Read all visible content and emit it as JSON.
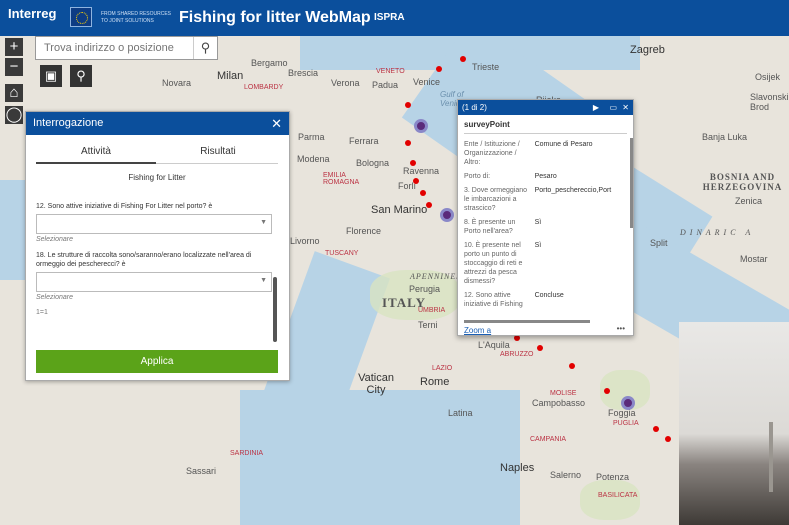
{
  "header": {
    "logo": "Interreg",
    "tagline": "FROM SHARED RESOURCES TO JOINT SOLUTIONS",
    "app_title": "Fishing for litter WebMap",
    "org": "ISPRA"
  },
  "search": {
    "placeholder": "Trova indirizzo o posizione"
  },
  "query_panel": {
    "title": "Interrogazione",
    "tabs": [
      "Attività",
      "Risultati"
    ],
    "subtitle": "Fishing for Litter",
    "questions": [
      {
        "text": "12. Sono attive iniziative di Fishing For Litter nel porto? è",
        "hint": "Selezionare"
      },
      {
        "text": "18. Le strutture di raccolta sono/saranno/erano localizzate nell'area di ormeggio dei pescherecci? è",
        "hint": "Selezionare"
      }
    ],
    "extra": "1=1",
    "apply_label": "Applica"
  },
  "popup": {
    "counter": "(1 di 2)",
    "layer": "surveyPoint",
    "rows": [
      {
        "k": "Ente / Istituzione / Organizzazione / Altro:",
        "v": "Comune di Pesaro"
      },
      {
        "k": "Porto di:",
        "v": "Pesaro"
      },
      {
        "k": "3. Dove ormeggiano le imbarcazioni a strascico?",
        "v": "Porto_peschereccio,Port"
      },
      {
        "k": "8. È presente un Porto nell'area?",
        "v": "Sì"
      },
      {
        "k": "10. È presente nel porto un punto di stoccaggio di reti e attrezzi da pesca dismessi?",
        "v": "Sì"
      },
      {
        "k": "12. Sono attive iniziative di Fishing",
        "v": "Concluse"
      }
    ],
    "zoom_label": "Zoom a",
    "more_label": "•••"
  },
  "map": {
    "places": [
      {
        "name": "Zagreb",
        "cls": "big"
      },
      {
        "name": "Trieste",
        "cls": ""
      },
      {
        "name": "Osijek",
        "cls": ""
      },
      {
        "name": "Bergamo",
        "cls": ""
      },
      {
        "name": "Brescia",
        "cls": ""
      },
      {
        "name": "Verona",
        "cls": ""
      },
      {
        "name": "Padua",
        "cls": ""
      },
      {
        "name": "Venice",
        "cls": ""
      },
      {
        "name": "Novara",
        "cls": ""
      },
      {
        "name": "Milan",
        "cls": "big"
      },
      {
        "name": "LOMBARDY",
        "cls": "region"
      },
      {
        "name": "VENETO",
        "cls": "region"
      },
      {
        "name": "Rijeka",
        "cls": ""
      },
      {
        "name": "Slavonski Brod",
        "cls": ""
      },
      {
        "name": "Banja Luka",
        "cls": ""
      },
      {
        "name": "Parma",
        "cls": ""
      },
      {
        "name": "Ferrara",
        "cls": ""
      },
      {
        "name": "Modena",
        "cls": ""
      },
      {
        "name": "Bologna",
        "cls": ""
      },
      {
        "name": "EMILIA ROMAGNA",
        "cls": "region"
      },
      {
        "name": "Ravenna",
        "cls": ""
      },
      {
        "name": "Forlì",
        "cls": ""
      },
      {
        "name": "San Marino",
        "cls": "big"
      },
      {
        "name": "Florence",
        "cls": ""
      },
      {
        "name": "Livorno",
        "cls": ""
      },
      {
        "name": "TUSCANY",
        "cls": "region"
      },
      {
        "name": "BOSNIA AND HERZEGOVINA",
        "cls": "country"
      },
      {
        "name": "Zenica",
        "cls": ""
      },
      {
        "name": "Split",
        "cls": ""
      },
      {
        "name": "Mostar",
        "cls": ""
      },
      {
        "name": "DINARIC A",
        "cls": "country"
      },
      {
        "name": "APENNINES",
        "cls": "country"
      },
      {
        "name": "Perugia",
        "cls": ""
      },
      {
        "name": "ITALY",
        "cls": "country"
      },
      {
        "name": "UMBRIA",
        "cls": "region"
      },
      {
        "name": "Terni",
        "cls": ""
      },
      {
        "name": "L'Aquila",
        "cls": ""
      },
      {
        "name": "ABRUZZO",
        "cls": "region"
      },
      {
        "name": "LAZIO",
        "cls": "region"
      },
      {
        "name": "Vatican City",
        "cls": "big"
      },
      {
        "name": "Rome",
        "cls": "big"
      },
      {
        "name": "MOLISE",
        "cls": "region"
      },
      {
        "name": "Campobasso",
        "cls": ""
      },
      {
        "name": "Foggia",
        "cls": ""
      },
      {
        "name": "PUGLIA",
        "cls": "region"
      },
      {
        "name": "Latina",
        "cls": ""
      },
      {
        "name": "CAMPANIA",
        "cls": "region"
      },
      {
        "name": "Naples",
        "cls": "big"
      },
      {
        "name": "Salerno",
        "cls": ""
      },
      {
        "name": "Potenza",
        "cls": ""
      },
      {
        "name": "BASILICATA",
        "cls": "region"
      },
      {
        "name": "SARDINIA",
        "cls": "region"
      },
      {
        "name": "Sassari",
        "cls": ""
      },
      {
        "name": "Gulf of Venice",
        "cls": "water"
      }
    ]
  }
}
